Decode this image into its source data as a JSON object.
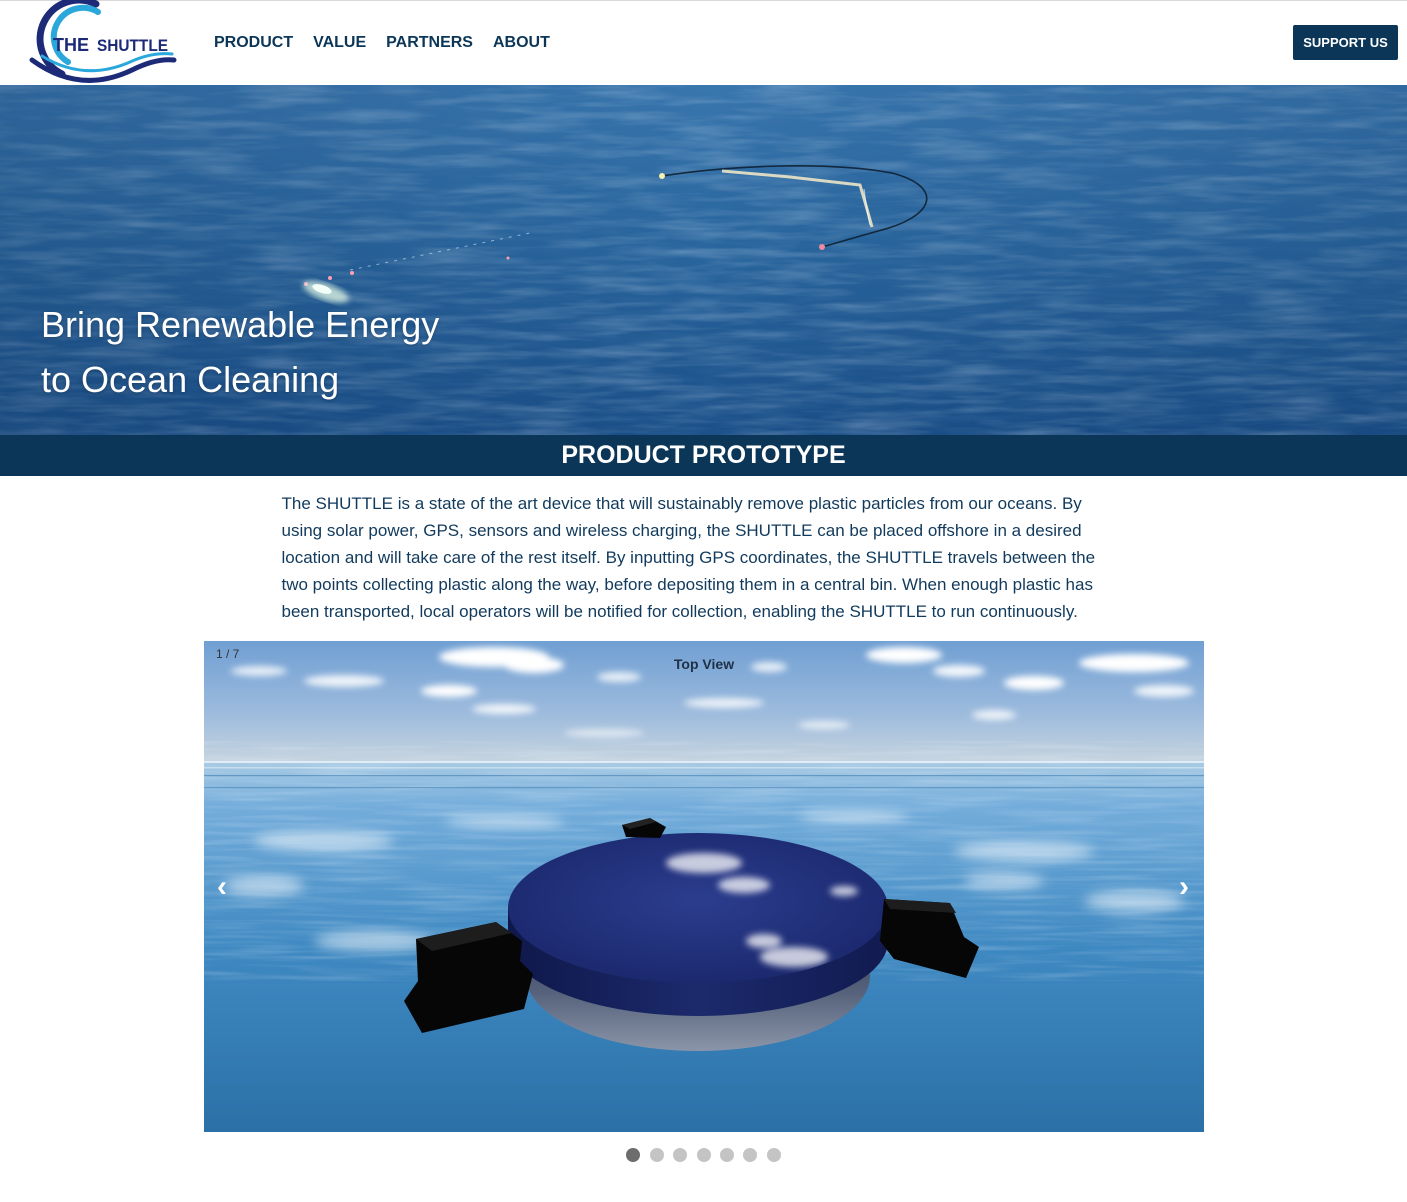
{
  "brand": {
    "logo_word_1": "THE",
    "logo_word_2": "SHUTTLE"
  },
  "nav": {
    "items": [
      {
        "label": "PRODUCT"
      },
      {
        "label": "VALUE"
      },
      {
        "label": "PARTNERS"
      },
      {
        "label": "ABOUT"
      }
    ]
  },
  "header": {
    "cta_label": "SUPPORT US"
  },
  "hero": {
    "line_1": "Bring Renewable Energy",
    "line_2": "to Ocean Cleaning"
  },
  "section": {
    "title": "PRODUCT PROTOTYPE",
    "description": "The SHUTTLE is a state of the art device that will sustainably remove plastic particles from our oceans. By using solar power, GPS, sensors and wireless charging, the SHUTTLE can be placed offshore in a desired location and will take care of the rest itself. By inputting GPS coordinates, the SHUTTLE travels between the two points collecting plastic along the way, before depositing them in a central bin. When enough plastic has been transported, local operators will be notified for collection, enabling the SHUTTLE to run continuously."
  },
  "carousel": {
    "counter": "1 / 7",
    "caption": "Top View",
    "prev_glyph": "‹",
    "next_glyph": "›",
    "prev_icon": "chevron-left-icon",
    "next_icon": "chevron-right-icon",
    "slide_count": 7,
    "active_index": 1
  },
  "colors": {
    "navy": "#0b3657",
    "text": "#113a5c",
    "logo_dark": "#1c2a78",
    "logo_light": "#2aa8dc",
    "dot_active": "#6d6d6d",
    "dot_inactive": "#c4c4c4"
  }
}
